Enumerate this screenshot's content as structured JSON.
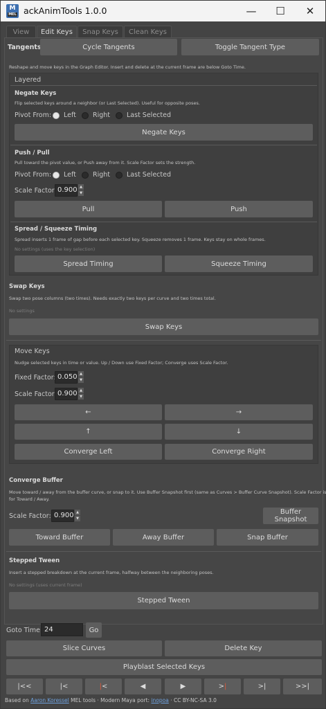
{
  "window": {
    "icon_text": "M",
    "icon_sub": "MEL",
    "title": "ackAnimTools 1.0.0",
    "minimize": "—",
    "maximize": "☐",
    "close": "✕"
  },
  "tabs": [
    "View",
    "Edit Keys",
    "Snap Keys",
    "Clean Keys"
  ],
  "active_tab": "Edit Keys",
  "tangents": {
    "label": "Tangents",
    "cycle": "Cycle Tangents",
    "toggle": "Toggle Tangent Type"
  },
  "intro": "Reshape and move keys in the Graph Editor. Insert and delete at the current frame are below Goto Time.",
  "layered": {
    "title": "Layered",
    "negate": {
      "title": "Negate Keys",
      "desc": "Flip selected keys around a neighbor (or Last Selected). Useful for opposite poses.",
      "pivot_label": "Pivot From:",
      "options": [
        "Left",
        "Right",
        "Last Selected"
      ],
      "selected": "Left",
      "button": "Negate Keys"
    },
    "push_pull": {
      "title": "Push / Pull",
      "desc": "Pull toward the pivot value, or Push away from it. Scale Factor sets the strength.",
      "pivot_label": "Pivot From:",
      "options": [
        "Left",
        "Right",
        "Last Selected"
      ],
      "selected": "Left",
      "scale_label": "Scale Factor:",
      "scale_value": "0.900",
      "pull": "Pull",
      "push": "Push"
    },
    "spread": {
      "title": "Spread / Squeeze Timing",
      "desc": "Spread inserts 1 frame of gap before each selected key. Squeeze removes 1 frame. Keys stay on whole frames.",
      "note": "No settings (uses the key selection)",
      "spread_btn": "Spread Timing",
      "squeeze_btn": "Squeeze Timing"
    }
  },
  "swap": {
    "title": "Swap Keys",
    "desc": "Swap two pose columns (two times). Needs exactly two keys per curve and two times total.",
    "note": "No settings",
    "button": "Swap Keys"
  },
  "move": {
    "title": "Move Keys",
    "desc": "Nudge selected keys in time or value. Up / Down use Fixed Factor; Converge uses Scale Factor.",
    "fixed_label": "Fixed Factor:",
    "fixed_value": "0.050",
    "scale_label": "Scale Factor:",
    "scale_value": "0.900",
    "left": "←",
    "right": "→",
    "up": "↑",
    "down": "↓",
    "converge_left": "Converge Left",
    "converge_right": "Converge Right"
  },
  "buffer": {
    "title": "Converge Buffer",
    "desc_line1": "Move toward / away from the buffer curve, or snap to it. Use Buffer Snapshot first (same as Curves > Buffer Curve Snapshot). Scale Factor is",
    "desc_line2": "for Toward / Away.",
    "scale_label": "Scale Factor:",
    "scale_value": "0.900",
    "snapshot": "Buffer Snapshot",
    "toward": "Toward Buffer",
    "away": "Away Buffer",
    "snap": "Snap Buffer"
  },
  "stepped": {
    "title": "Stepped Tween",
    "desc": "Insert a stepped breakdown at the current frame, halfway between the neighboring poses.",
    "note": "No settings (uses current frame)",
    "button": "Stepped Tween"
  },
  "goto": {
    "label": "Goto Time:",
    "value": "24",
    "go": "Go"
  },
  "actions": {
    "slice": "Slice Curves",
    "delete": "Delete Key",
    "playblast": "Playblast Selected Keys"
  },
  "transport": [
    {
      "name": "first-key",
      "a": "|<<",
      "b": ""
    },
    {
      "name": "prev-key",
      "a": "|<",
      "b": ""
    },
    {
      "name": "prev-frame-marker",
      "a": "|",
      "b": "<",
      "red_first": true
    },
    {
      "name": "prev-frame",
      "a": "◀",
      "b": ""
    },
    {
      "name": "next-frame",
      "a": "▶",
      "b": ""
    },
    {
      "name": "next-frame-marker",
      "a": ">",
      "b": "|",
      "red_second": true
    },
    {
      "name": "next-key",
      "a": ">|",
      "b": ""
    },
    {
      "name": "last-key",
      "a": ">>|",
      "b": ""
    }
  ],
  "footer": {
    "based_on": "Based on",
    "author": "Aaron Koressel",
    "mel_tools": "MEL tools",
    "dot1": "·",
    "port_label": "Modern Maya port:",
    "port_author": "inopoa",
    "dot2": "·",
    "license": "CC BY-NC-SA 3.0"
  },
  "colors": {
    "panel_bg": "#464646",
    "button_bg": "#5d5d5d",
    "field_bg": "#2b2b2b",
    "link": "#6fa2df",
    "marker_red": "#e05a3a"
  }
}
